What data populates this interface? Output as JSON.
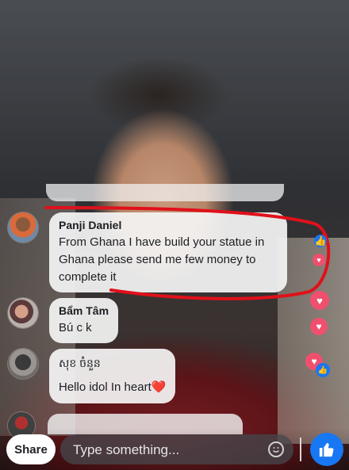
{
  "comments": [
    {
      "name": "Panji Daniel",
      "text": "From Ghana I have build your statue in Ghana please send me few money to complete it",
      "highlighted": true
    },
    {
      "name": "Bẩm Tâm",
      "text": "Bú c k"
    },
    {
      "name": "សុខ ចំនួន",
      "text": "Hello idol In heart❤️"
    }
  ],
  "ghost_comment_text": "...",
  "annotation_color": "#e0101a",
  "reactions": [
    "like-icon",
    "heart-icon",
    "heart-icon",
    "heart-icon",
    "heart-icon",
    "like-icon"
  ],
  "composer": {
    "share_label": "Share",
    "placeholder": "Type something..."
  },
  "colors": {
    "bubble": "#f5f5f5",
    "like_blue": "#1877f2",
    "heart_red": "#f0506e"
  }
}
